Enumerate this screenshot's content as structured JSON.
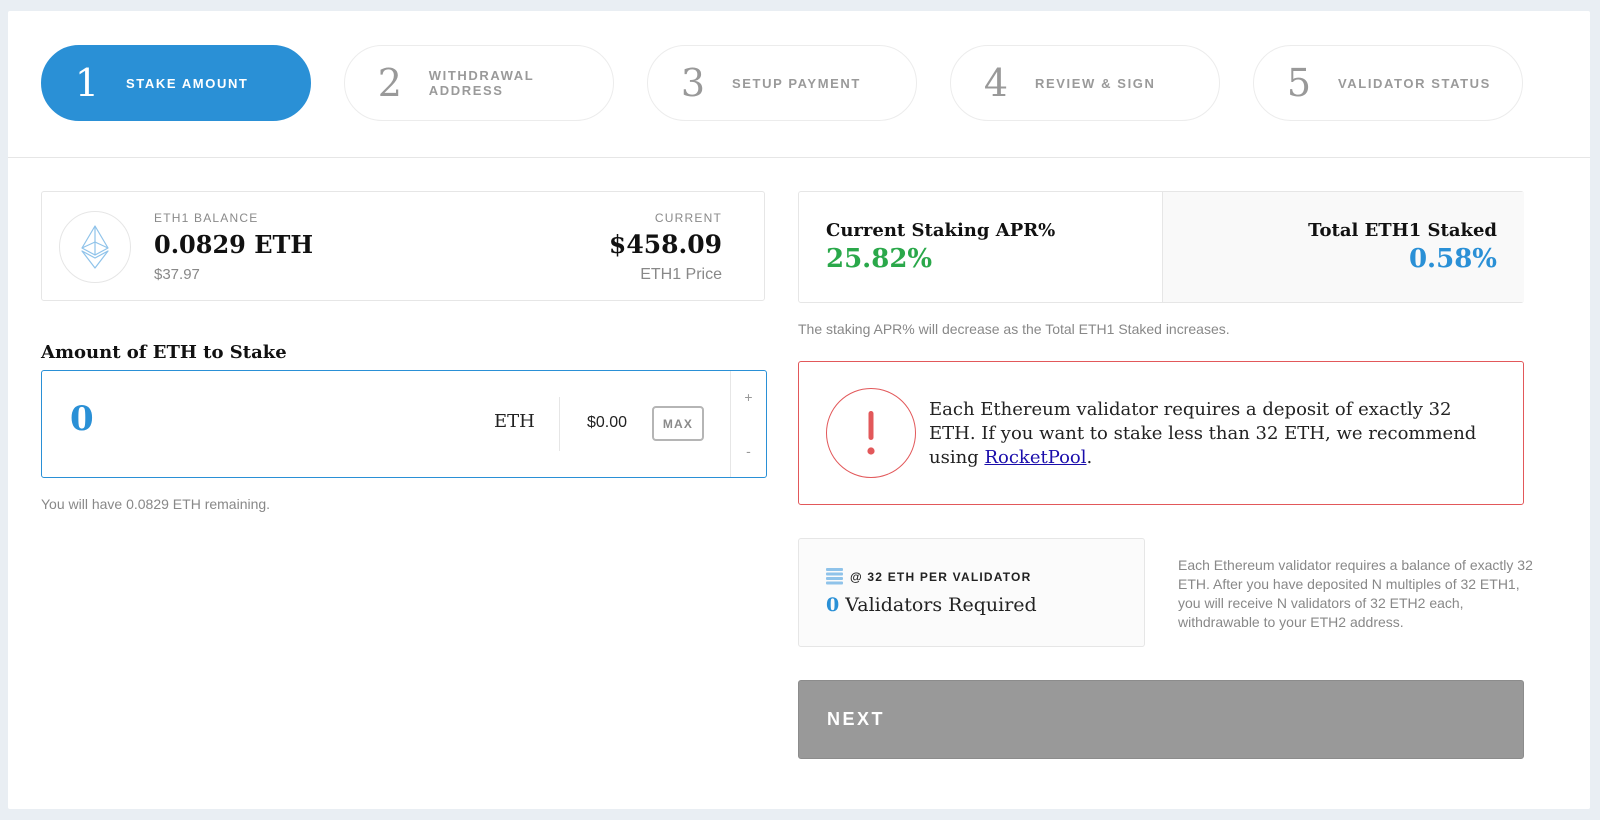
{
  "steps": [
    {
      "num": "1",
      "label": "STAKE AMOUNT"
    },
    {
      "num": "2",
      "label": "WITHDRAWAL ADDRESS"
    },
    {
      "num": "3",
      "label": "SETUP PAYMENT"
    },
    {
      "num": "4",
      "label": "REVIEW & SIGN"
    },
    {
      "num": "5",
      "label": "VALIDATOR STATUS"
    }
  ],
  "balance": {
    "label": "ETH1 BALANCE",
    "value": "0.0829 ETH",
    "usd": "$37.97",
    "current_label": "CURRENT",
    "price": "$458.09",
    "price_label": "ETH1 Price"
  },
  "stake": {
    "title": "Amount of ETH to Stake",
    "value": "0",
    "unit": "ETH",
    "usd": "$0.00",
    "max_label": "MAX",
    "plus": "+",
    "minus": "-",
    "remaining": "You will have 0.0829 ETH remaining."
  },
  "apr": {
    "title": "Current Staking APR%",
    "value": "25.82%",
    "total_title": "Total ETH1 Staked",
    "total_value": "0.58%",
    "note": "The staking APR% will decrease as the Total ETH1 Staked increases.",
    "apr_color": "#2aa84a",
    "total_color": "#2a90d6"
  },
  "warning": {
    "text_before": "Each Ethereum validator requires a deposit of exactly 32 ETH. If you want to stake less than 32 ETH, we recommend using ",
    "link": "RocketPool",
    "text_after": "."
  },
  "validators": {
    "header": "@ 32 ETH PER VALIDATOR",
    "count": "0",
    "required_label": "Validators Required",
    "note": "Each Ethereum validator requires a balance of exactly 32 ETH. After you have deposited N multiples of 32 ETH1, you will receive N validators of 32 ETH2 each, withdrawable to your ETH2 address."
  },
  "next_label": "NEXT",
  "icons": {
    "eth": "ethereum-icon",
    "warning": "exclamation-icon",
    "stack": "stack-icon"
  }
}
